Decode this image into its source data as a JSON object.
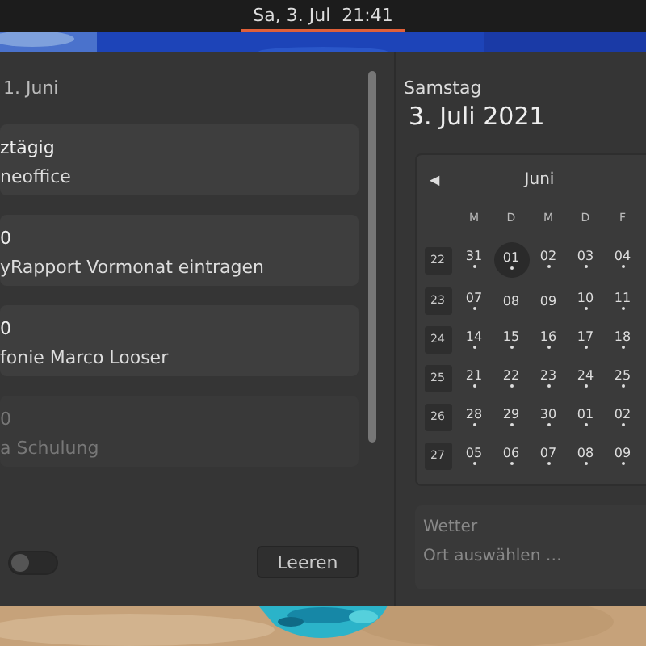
{
  "top_bar": {
    "clock": "Sa, 3. Jul  21:41"
  },
  "notifications": {
    "date_heading": "1. Juni",
    "events": [
      {
        "time": "ztägig",
        "title": "neoffice",
        "dimmed": false
      },
      {
        "time": "0",
        "title": "yRapport Vormonat eintragen",
        "dimmed": false
      },
      {
        "time": "0",
        "title": "fonie Marco Looser",
        "dimmed": false
      },
      {
        "time": "0",
        "title": "a Schulung",
        "dimmed": true
      }
    ],
    "do_not_disturb": {
      "on": false
    },
    "clear_button": "Leeren"
  },
  "calendar": {
    "weekday": "Samstag",
    "date": "3. Juli 2021",
    "prev": "◀",
    "month": "Juni",
    "weekdays": [
      "M",
      "D",
      "M",
      "D",
      "F"
    ],
    "weeks": [
      {
        "number": "22",
        "days": [
          {
            "label": "31",
            "has_events": true,
            "selected": false
          },
          {
            "label": "01",
            "has_events": true,
            "selected": true
          },
          {
            "label": "02",
            "has_events": true,
            "selected": false
          },
          {
            "label": "03",
            "has_events": true,
            "selected": false
          },
          {
            "label": "04",
            "has_events": true,
            "selected": false
          }
        ]
      },
      {
        "number": "23",
        "days": [
          {
            "label": "07",
            "has_events": true,
            "selected": false
          },
          {
            "label": "08",
            "has_events": false,
            "selected": false
          },
          {
            "label": "09",
            "has_events": false,
            "selected": false
          },
          {
            "label": "10",
            "has_events": true,
            "selected": false
          },
          {
            "label": "11",
            "has_events": true,
            "selected": false
          }
        ]
      },
      {
        "number": "24",
        "days": [
          {
            "label": "14",
            "has_events": true,
            "selected": false
          },
          {
            "label": "15",
            "has_events": true,
            "selected": false
          },
          {
            "label": "16",
            "has_events": true,
            "selected": false
          },
          {
            "label": "17",
            "has_events": true,
            "selected": false
          },
          {
            "label": "18",
            "has_events": true,
            "selected": false
          }
        ]
      },
      {
        "number": "25",
        "days": [
          {
            "label": "21",
            "has_events": true,
            "selected": false
          },
          {
            "label": "22",
            "has_events": true,
            "selected": false
          },
          {
            "label": "23",
            "has_events": true,
            "selected": false
          },
          {
            "label": "24",
            "has_events": true,
            "selected": false
          },
          {
            "label": "25",
            "has_events": true,
            "selected": false
          }
        ]
      },
      {
        "number": "26",
        "days": [
          {
            "label": "28",
            "has_events": true,
            "selected": false
          },
          {
            "label": "29",
            "has_events": true,
            "selected": false
          },
          {
            "label": "30",
            "has_events": true,
            "selected": false
          },
          {
            "label": "01",
            "has_events": true,
            "selected": false
          },
          {
            "label": "02",
            "has_events": true,
            "selected": false
          }
        ]
      },
      {
        "number": "27",
        "days": [
          {
            "label": "05",
            "has_events": true,
            "selected": false
          },
          {
            "label": "06",
            "has_events": true,
            "selected": false
          },
          {
            "label": "07",
            "has_events": true,
            "selected": false
          },
          {
            "label": "08",
            "has_events": true,
            "selected": false
          },
          {
            "label": "09",
            "has_events": true,
            "selected": false
          }
        ]
      }
    ]
  },
  "weather": {
    "title": "Wetter",
    "placeholder": "Ort auswählen …"
  }
}
